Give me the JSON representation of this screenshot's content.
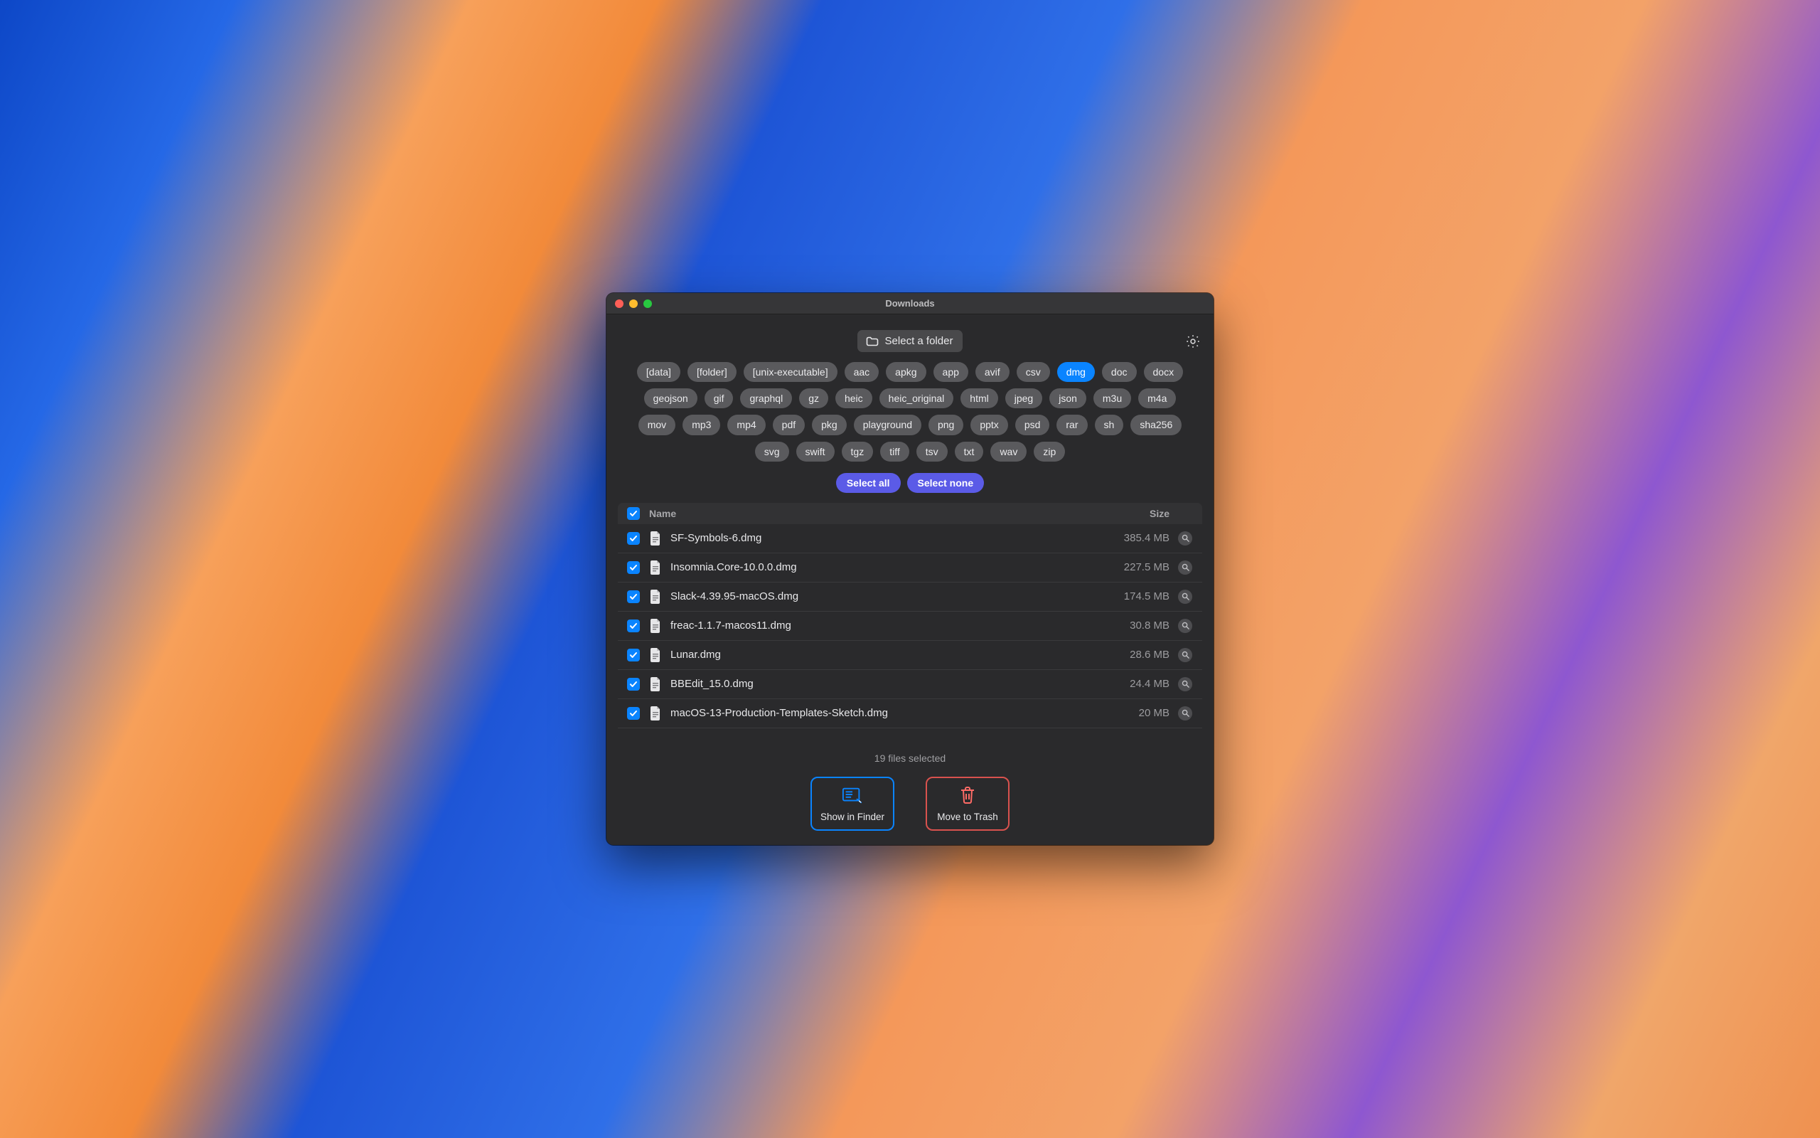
{
  "window": {
    "title": "Downloads"
  },
  "toolbar": {
    "select_folder_label": "Select a folder",
    "select_all": "Select all",
    "select_none": "Select none"
  },
  "tags": [
    {
      "label": "[data]",
      "active": false
    },
    {
      "label": "[folder]",
      "active": false
    },
    {
      "label": "[unix-executable]",
      "active": false
    },
    {
      "label": "aac",
      "active": false
    },
    {
      "label": "apkg",
      "active": false
    },
    {
      "label": "app",
      "active": false
    },
    {
      "label": "avif",
      "active": false
    },
    {
      "label": "csv",
      "active": false
    },
    {
      "label": "dmg",
      "active": true
    },
    {
      "label": "doc",
      "active": false
    },
    {
      "label": "docx",
      "active": false
    },
    {
      "label": "geojson",
      "active": false
    },
    {
      "label": "gif",
      "active": false
    },
    {
      "label": "graphql",
      "active": false
    },
    {
      "label": "gz",
      "active": false
    },
    {
      "label": "heic",
      "active": false
    },
    {
      "label": "heic_original",
      "active": false
    },
    {
      "label": "html",
      "active": false
    },
    {
      "label": "jpeg",
      "active": false
    },
    {
      "label": "json",
      "active": false
    },
    {
      "label": "m3u",
      "active": false
    },
    {
      "label": "m4a",
      "active": false
    },
    {
      "label": "mov",
      "active": false
    },
    {
      "label": "mp3",
      "active": false
    },
    {
      "label": "mp4",
      "active": false
    },
    {
      "label": "pdf",
      "active": false
    },
    {
      "label": "pkg",
      "active": false
    },
    {
      "label": "playground",
      "active": false
    },
    {
      "label": "png",
      "active": false
    },
    {
      "label": "pptx",
      "active": false
    },
    {
      "label": "psd",
      "active": false
    },
    {
      "label": "rar",
      "active": false
    },
    {
      "label": "sh",
      "active": false
    },
    {
      "label": "sha256",
      "active": false
    },
    {
      "label": "svg",
      "active": false
    },
    {
      "label": "swift",
      "active": false
    },
    {
      "label": "tgz",
      "active": false
    },
    {
      "label": "tiff",
      "active": false
    },
    {
      "label": "tsv",
      "active": false
    },
    {
      "label": "txt",
      "active": false
    },
    {
      "label": "wav",
      "active": false
    },
    {
      "label": "zip",
      "active": false
    }
  ],
  "columns": {
    "name": "Name",
    "size": "Size"
  },
  "files": [
    {
      "name": "SF-Symbols-6.dmg",
      "size": "385.4 MB",
      "checked": true
    },
    {
      "name": "Insomnia.Core-10.0.0.dmg",
      "size": "227.5 MB",
      "checked": true
    },
    {
      "name": "Slack-4.39.95-macOS.dmg",
      "size": "174.5 MB",
      "checked": true
    },
    {
      "name": "freac-1.1.7-macos11.dmg",
      "size": "30.8 MB",
      "checked": true
    },
    {
      "name": "Lunar.dmg",
      "size": "28.6 MB",
      "checked": true
    },
    {
      "name": "BBEdit_15.0.dmg",
      "size": "24.4 MB",
      "checked": true
    },
    {
      "name": "macOS-13-Production-Templates-Sketch.dmg",
      "size": "20 MB",
      "checked": true
    }
  ],
  "status": "19 files selected",
  "actions": {
    "show_in_finder": "Show in Finder",
    "move_to_trash": "Move to Trash"
  }
}
